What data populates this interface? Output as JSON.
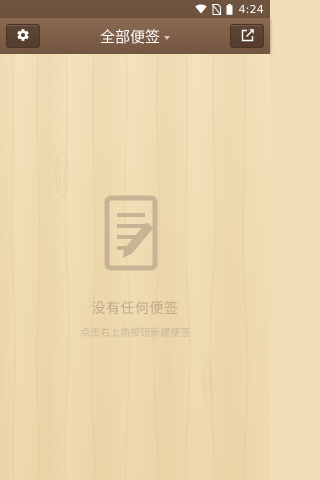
{
  "status_bar": {
    "time": "4:24",
    "icons": [
      "wifi-icon",
      "no-sim-icon",
      "battery-icon"
    ]
  },
  "toolbar": {
    "title": "全部便签",
    "left_icon": "gear-icon",
    "right_icon": "new-note-icon",
    "title_icon": "dropdown-arrow-icon"
  },
  "empty_state": {
    "icon": "note-edit-icon",
    "title": "没有任何便签",
    "hint": "点击右上角按钮新建便签"
  },
  "colors": {
    "toolbar": "#7d5f49",
    "status_bar": "#6e5340",
    "background": "#f1deb6",
    "empty_text": "#bfa98b"
  }
}
